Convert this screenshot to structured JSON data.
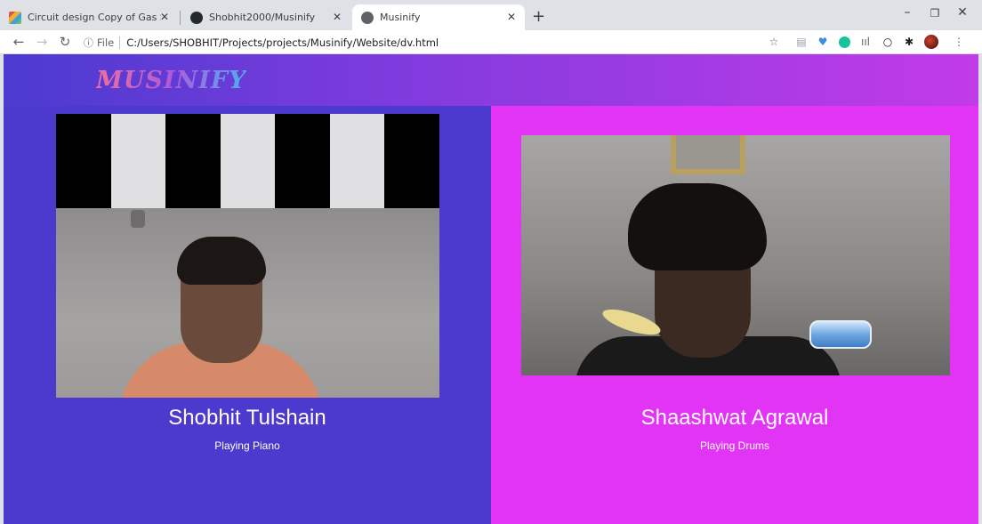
{
  "browser": {
    "tabs": [
      {
        "title": "Circuit design Copy of Gas Senso",
        "icon": "tinkercad-icon"
      },
      {
        "title": "Shobhit2000/Musinify",
        "icon": "github-icon"
      },
      {
        "title": "Musinify",
        "icon": "globe-icon"
      }
    ],
    "address": {
      "scheme_label": "File",
      "url": "C:/Users/SHOBHIT/Projects/projects/Musinify/Website/dv.html"
    }
  },
  "page": {
    "logo": "MUSINIFY",
    "performers": [
      {
        "name": "Shobhit Tulshain",
        "activity": "Playing Piano"
      },
      {
        "name": "Shaashwat Agrawal",
        "activity": "Playing Drums"
      }
    ]
  },
  "colors": {
    "left_panel": "#4c3ace",
    "right_panel": "#e234f4",
    "header_start": "#4b3bd0",
    "header_end": "#c23be8"
  }
}
